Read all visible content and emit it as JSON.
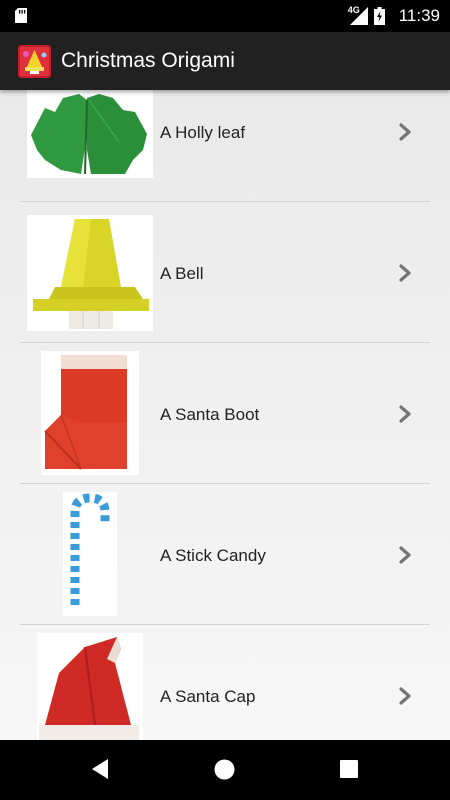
{
  "status_bar": {
    "network": "4G",
    "time": "11:39"
  },
  "app_bar": {
    "title": "Christmas Origami",
    "icon": "app-logo-icon"
  },
  "items": [
    {
      "label": "A Holly leaf",
      "thumbnail": "holly-leaf-image"
    },
    {
      "label": "A Bell",
      "thumbnail": "bell-image"
    },
    {
      "label": "A Santa Boot",
      "thumbnail": "santa-boot-image"
    },
    {
      "label": "A Stick Candy",
      "thumbnail": "stick-candy-image"
    },
    {
      "label": "A Santa Cap",
      "thumbnail": "santa-cap-image"
    }
  ],
  "nav_bar": {
    "buttons": [
      "back-icon",
      "home-icon",
      "recents-icon"
    ]
  }
}
